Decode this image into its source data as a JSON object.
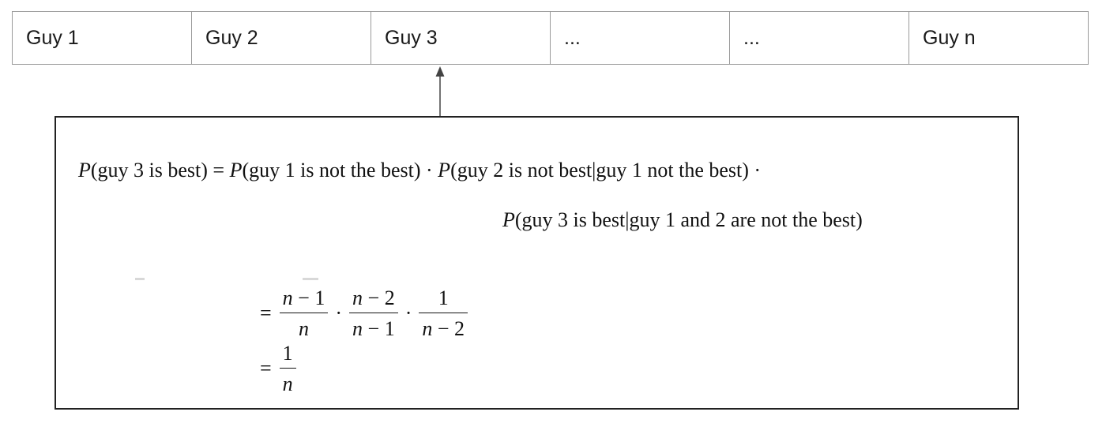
{
  "cells": [
    "Guy 1",
    "Guy 2",
    "Guy 3",
    "...",
    "...",
    "Guy n"
  ],
  "formula": {
    "line1_parts": [
      {
        "t": "P",
        "it": true
      },
      {
        "t": "(guy 3 is best) = ",
        "it": false
      },
      {
        "t": "P",
        "it": true
      },
      {
        "t": "(guy 1 is not the best) · ",
        "it": false
      },
      {
        "t": "P",
        "it": true
      },
      {
        "t": "(guy 2 is not best|guy 1 not the best) ·",
        "it": false
      }
    ],
    "line2_parts": [
      {
        "t": "P",
        "it": true
      },
      {
        "t": "(guy 3 is best|guy 1 and 2 are not the best)",
        "it": false
      }
    ],
    "eq1": {
      "equals": "=",
      "dot": "·",
      "fractions": [
        {
          "num": "n − 1",
          "den": "n"
        },
        {
          "num": "n − 2",
          "den": "n − 1"
        },
        {
          "num": "1",
          "den": "n − 2"
        }
      ]
    },
    "eq2": {
      "equals": "=",
      "fraction": {
        "num": "1",
        "den": "n"
      }
    }
  }
}
